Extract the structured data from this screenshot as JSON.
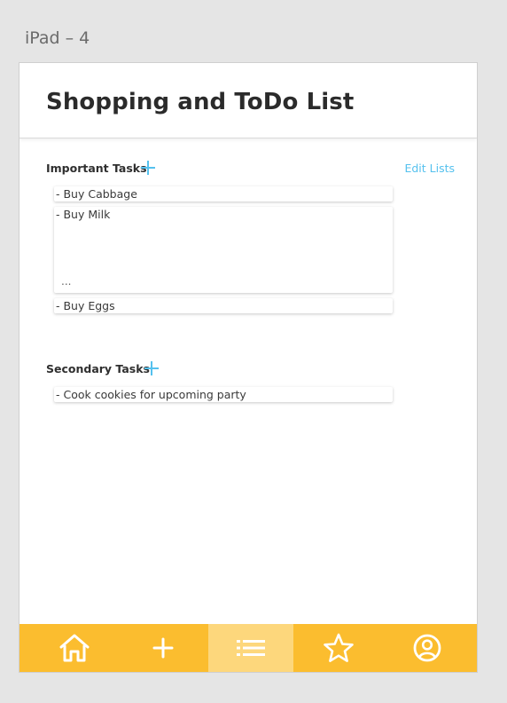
{
  "artboard": {
    "label": "iPad – 4"
  },
  "header": {
    "title": "Shopping and ToDo List"
  },
  "actions": {
    "edit_lists": "Edit Lists"
  },
  "sections": [
    {
      "title": "Important Tasks",
      "tasks": [
        {
          "text": "- Buy Cabbage"
        },
        {
          "text": "- Buy Milk",
          "extra": "..."
        },
        {
          "text": "- Buy Eggs"
        }
      ]
    },
    {
      "title": "Secondary Tasks",
      "tasks": [
        {
          "text": "- Cook cookies for upcoming party"
        }
      ]
    }
  ],
  "tabbar": {
    "background": "#fbbd2f",
    "active_background": "#fdd77c",
    "tabs": [
      {
        "icon": "home-icon",
        "active": false
      },
      {
        "icon": "plus-icon",
        "active": false
      },
      {
        "icon": "list-icon",
        "active": true
      },
      {
        "icon": "star-icon",
        "active": false
      },
      {
        "icon": "user-icon",
        "active": false
      }
    ]
  },
  "colors": {
    "accent": "#55c1ee"
  }
}
